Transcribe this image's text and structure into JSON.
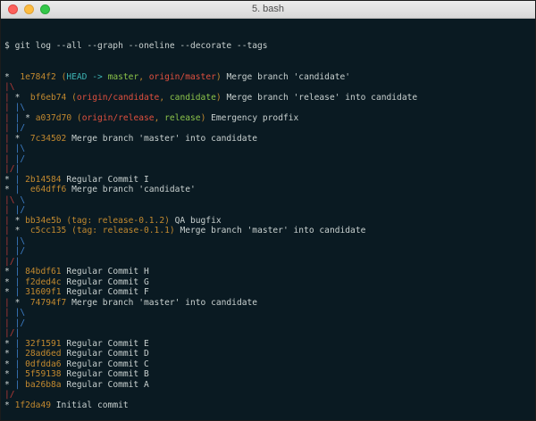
{
  "window": {
    "title": "5. bash"
  },
  "terminal": {
    "prompt": "$",
    "command": "git log --all --graph --oneline --decorate --tags",
    "lines": [
      {
        "graph": "*  ",
        "hash": "1e784f2",
        "refs": [
          {
            "t": "paren",
            "v": "("
          },
          {
            "t": "head",
            "v": "HEAD -> "
          },
          {
            "t": "branch",
            "v": "master"
          },
          {
            "t": "paren",
            "v": ", "
          },
          {
            "t": "remote",
            "v": "origin/master"
          },
          {
            "t": "paren",
            "v": ")"
          }
        ],
        "msg": "Merge branch 'candidate'"
      },
      {
        "graph": "|\\",
        "hash": "",
        "refs": [],
        "msg": ""
      },
      {
        "graph": "| *  ",
        "hash": "bf6eb74",
        "refs": [
          {
            "t": "paren",
            "v": "("
          },
          {
            "t": "remote",
            "v": "origin/candidate"
          },
          {
            "t": "paren",
            "v": ", "
          },
          {
            "t": "branch",
            "v": "candidate"
          },
          {
            "t": "paren",
            "v": ")"
          }
        ],
        "msg": "Merge branch 'release' into candidate"
      },
      {
        "graph": "| |\\",
        "hash": "",
        "refs": [],
        "msg": ""
      },
      {
        "graph": "| | * ",
        "hash": "a037d70",
        "refs": [
          {
            "t": "paren",
            "v": "("
          },
          {
            "t": "remote",
            "v": "origin/release"
          },
          {
            "t": "paren",
            "v": ", "
          },
          {
            "t": "branch",
            "v": "release"
          },
          {
            "t": "paren",
            "v": ")"
          }
        ],
        "msg": "Emergency prodfix"
      },
      {
        "graph": "| |/",
        "hash": "",
        "refs": [],
        "msg": ""
      },
      {
        "graph": "| *  ",
        "hash": "7c34502",
        "refs": [],
        "msg": "Merge branch 'master' into candidate"
      },
      {
        "graph": "| |\\",
        "hash": "",
        "refs": [],
        "msg": ""
      },
      {
        "graph": "| |/",
        "hash": "",
        "refs": [],
        "msg": ""
      },
      {
        "graph": "|/|",
        "hash": "",
        "refs": [],
        "msg": ""
      },
      {
        "graph": "* | ",
        "hash": "2b14584",
        "refs": [],
        "msg": "Regular Commit I"
      },
      {
        "graph": "* |  ",
        "hash": "e64dff6",
        "refs": [],
        "msg": "Merge branch 'candidate'"
      },
      {
        "graph": "|\\ \\",
        "hash": "",
        "refs": [],
        "msg": ""
      },
      {
        "graph": "| |/",
        "hash": "",
        "refs": [],
        "msg": ""
      },
      {
        "graph": "| * ",
        "hash": "bb34e5b",
        "refs": [
          {
            "t": "paren",
            "v": "("
          },
          {
            "t": "tag",
            "v": "tag: release-0.1.2"
          },
          {
            "t": "paren",
            "v": ")"
          }
        ],
        "msg": "QA bugfix"
      },
      {
        "graph": "| *  ",
        "hash": "c5cc135",
        "refs": [
          {
            "t": "paren",
            "v": "("
          },
          {
            "t": "tag",
            "v": "tag: release-0.1.1"
          },
          {
            "t": "paren",
            "v": ")"
          }
        ],
        "msg": "Merge branch 'master' into candidate"
      },
      {
        "graph": "| |\\",
        "hash": "",
        "refs": [],
        "msg": ""
      },
      {
        "graph": "| |/",
        "hash": "",
        "refs": [],
        "msg": ""
      },
      {
        "graph": "|/|",
        "hash": "",
        "refs": [],
        "msg": ""
      },
      {
        "graph": "* | ",
        "hash": "84bdf61",
        "refs": [],
        "msg": "Regular Commit H"
      },
      {
        "graph": "* | ",
        "hash": "f2ded4c",
        "refs": [],
        "msg": "Regular Commit G"
      },
      {
        "graph": "* | ",
        "hash": "31609f1",
        "refs": [],
        "msg": "Regular Commit F"
      },
      {
        "graph": "| *  ",
        "hash": "74794f7",
        "refs": [],
        "msg": "Merge branch 'master' into candidate"
      },
      {
        "graph": "| |\\",
        "hash": "",
        "refs": [],
        "msg": ""
      },
      {
        "graph": "| |/",
        "hash": "",
        "refs": [],
        "msg": ""
      },
      {
        "graph": "|/|",
        "hash": "",
        "refs": [],
        "msg": ""
      },
      {
        "graph": "* | ",
        "hash": "32f1591",
        "refs": [],
        "msg": "Regular Commit E"
      },
      {
        "graph": "* | ",
        "hash": "28ad6ed",
        "refs": [],
        "msg": "Regular Commit D"
      },
      {
        "graph": "* | ",
        "hash": "0dfdda6",
        "refs": [],
        "msg": "Regular Commit C"
      },
      {
        "graph": "* | ",
        "hash": "5f59138",
        "refs": [],
        "msg": "Regular Commit B"
      },
      {
        "graph": "* | ",
        "hash": "ba26b8a",
        "refs": [],
        "msg": "Regular Commit A"
      },
      {
        "graph": "|/",
        "hash": "",
        "refs": [],
        "msg": ""
      },
      {
        "graph": "* ",
        "hash": "1f2da49",
        "refs": [],
        "msg": "Initial commit"
      }
    ],
    "end_prompt": "$"
  },
  "colors": {
    "background": "#0a1a22",
    "text": "#c8d0cf",
    "hash": "#c2892f",
    "head": "#3db3b3",
    "branch": "#8bc34a",
    "remote": "#e0503f"
  }
}
